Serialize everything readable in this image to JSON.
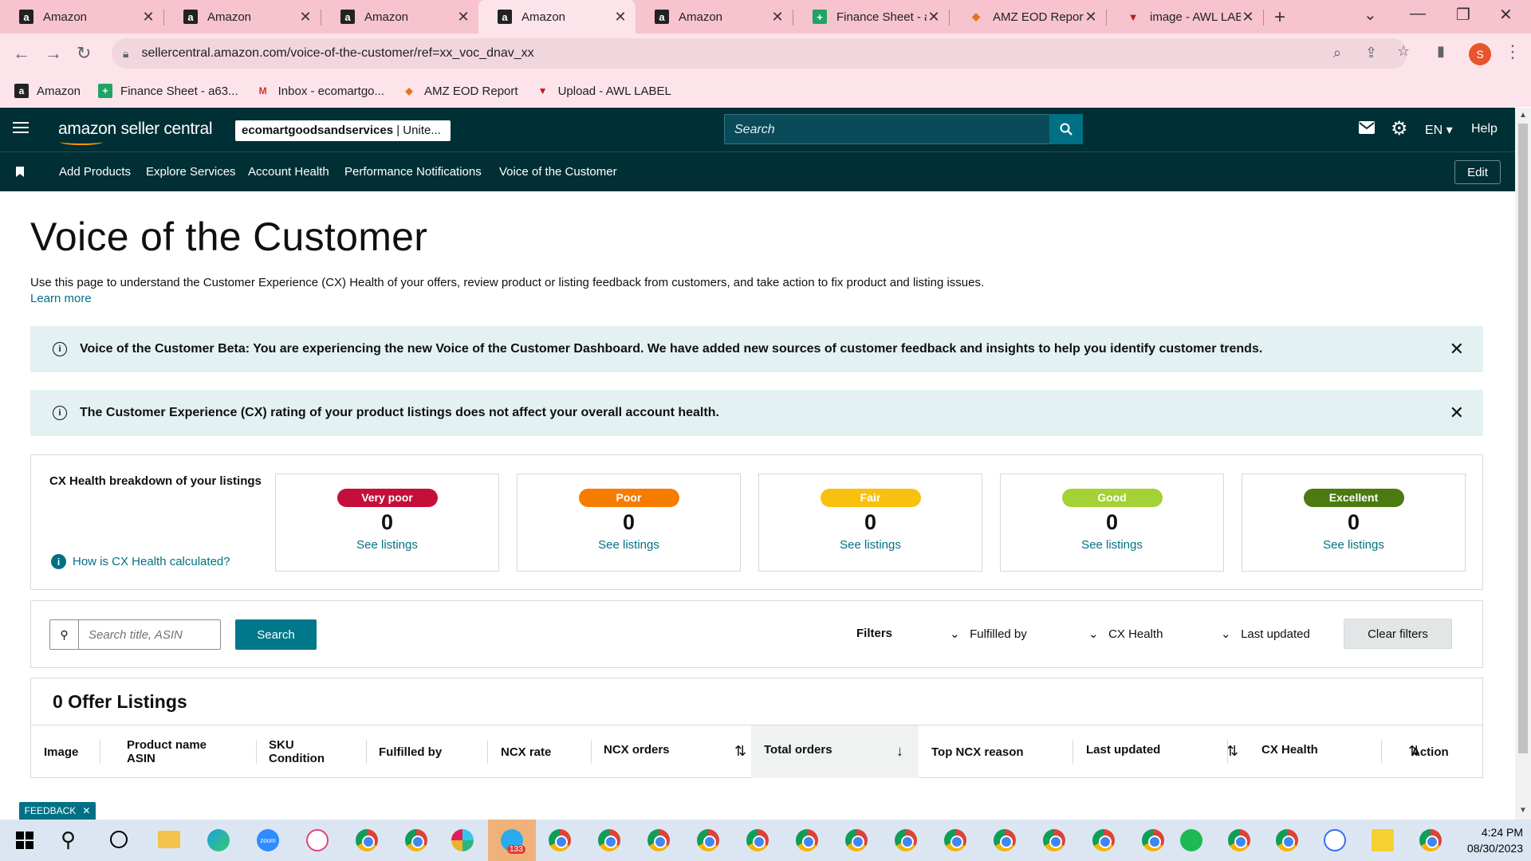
{
  "browser": {
    "tabs": [
      {
        "title": "Amazon",
        "icon": "amazon-icon",
        "active": false
      },
      {
        "title": "Amazon",
        "icon": "amazon-icon",
        "active": false
      },
      {
        "title": "Amazon",
        "icon": "amazon-icon",
        "active": false
      },
      {
        "title": "Amazon",
        "icon": "amazon-icon",
        "active": true
      },
      {
        "title": "Amazon",
        "icon": "amazon-icon",
        "active": false
      },
      {
        "title": "Finance Sheet - a",
        "icon": "sheets-icon",
        "active": false
      },
      {
        "title": "AMZ EOD Report",
        "icon": "eod-icon",
        "active": false
      },
      {
        "title": "image - AWL LAB",
        "icon": "awl-icon",
        "active": false
      }
    ],
    "url": "sellercentral.amazon.com/voice-of-the-customer/ref=xx_voc_dnav_xx",
    "profile_initial": "S",
    "bookmarks": [
      {
        "label": "Amazon",
        "icon": "amazon-icon"
      },
      {
        "label": "Finance Sheet - a63...",
        "icon": "sheets-icon"
      },
      {
        "label": "Inbox - ecomartgo...",
        "icon": "gmail-icon"
      },
      {
        "label": "AMZ EOD Report",
        "icon": "eod-icon"
      },
      {
        "label": "Upload - AWL LABEL",
        "icon": "awl-icon"
      }
    ]
  },
  "header": {
    "logo": "amazon seller central",
    "store_bold": "ecomartgoodsandservices",
    "store_rest": " | Unite...",
    "search_placeholder": "Search",
    "language": "EN",
    "help": "Help"
  },
  "nav": {
    "items": [
      "Add Products",
      "Explore Services",
      "Account Health",
      "Performance Notifications",
      "Voice of the Customer"
    ],
    "edit": "Edit"
  },
  "page": {
    "title": "Voice of the Customer",
    "intro": "Use this page to understand the Customer Experience (CX) Health of your offers, review product or listing feedback from customers, and take action to fix product and listing issues.",
    "learn_more": "Learn more",
    "alert_beta": "Voice of the Customer Beta: You are experiencing the new Voice of the Customer Dashboard. We have added new sources of customer feedback and insights to help you identify customer trends.",
    "alert_cx": "The Customer Experience (CX) rating of your product listings does not affect your overall account health."
  },
  "cx": {
    "title": "CX Health breakdown of your listings",
    "how": "How is CX Health calculated?",
    "cards": [
      {
        "label": "Very poor",
        "count": "0",
        "link": "See listings",
        "color": "#c40f3b"
      },
      {
        "label": "Poor",
        "count": "0",
        "link": "See listings",
        "color": "#f57c00"
      },
      {
        "label": "Fair",
        "count": "0",
        "link": "See listings",
        "color": "#f9c10f"
      },
      {
        "label": "Good",
        "count": "0",
        "link": "See listings",
        "color": "#a2d233"
      },
      {
        "label": "Excellent",
        "count": "0",
        "link": "See listings",
        "color": "#4b7a10"
      }
    ]
  },
  "filters": {
    "search_placeholder": "Search title, ASIN",
    "search_btn": "Search",
    "label": "Filters",
    "fulfilled_by": "Fulfilled by",
    "cx_health": "CX Health",
    "last_updated": "Last updated",
    "clear": "Clear filters"
  },
  "table": {
    "title": "0 Offer Listings",
    "columns": [
      {
        "l1": "Image",
        "l2": ""
      },
      {
        "l1": "Product name",
        "l2": "ASIN"
      },
      {
        "l1": "SKU",
        "l2": "Condition"
      },
      {
        "l1": "Fulfilled by",
        "l2": ""
      },
      {
        "l1": "NCX rate",
        "l2": ""
      },
      {
        "l1": "NCX orders",
        "l2": ""
      },
      {
        "l1": "Total orders",
        "l2": ""
      },
      {
        "l1": "Top NCX reason",
        "l2": ""
      },
      {
        "l1": "Last updated",
        "l2": ""
      },
      {
        "l1": "CX Health",
        "l2": ""
      },
      {
        "l1": "Action",
        "l2": ""
      }
    ]
  },
  "feedback": "FEEDBACK",
  "taskbar": {
    "time": "4:24 PM",
    "date": "08/30/2023",
    "telegram_badge": "133"
  }
}
